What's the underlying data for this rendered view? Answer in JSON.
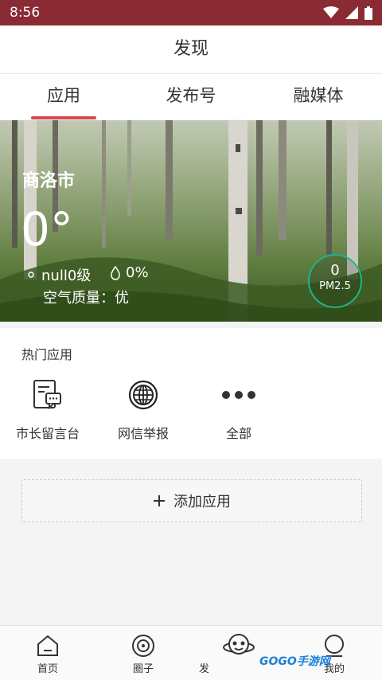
{
  "status": {
    "time": "8:56"
  },
  "page": {
    "title": "发现"
  },
  "tabs": [
    {
      "label": "应用"
    },
    {
      "label": "发布号"
    },
    {
      "label": "融媒体"
    }
  ],
  "weather": {
    "city": "商洛市",
    "temperature": "0°",
    "wind": "null0级",
    "humidity": "0%",
    "air_quality": "空气质量：优",
    "pm_value": "0",
    "pm_label": "PM2.5",
    "accent_color": "#1fb58d"
  },
  "hot_apps": {
    "heading": "热门应用",
    "items": [
      {
        "label": "市长留言台",
        "icon": "message-board-icon"
      },
      {
        "label": "网信举报",
        "icon": "globe-icon"
      },
      {
        "label": "全部",
        "icon": "more-dots-icon"
      }
    ]
  },
  "add_app": {
    "label": "添加应用"
  },
  "bottom_nav": [
    {
      "label": "首页",
      "icon": "home-icon"
    },
    {
      "label": "圈子",
      "icon": "circle-icon"
    },
    {
      "label": "发",
      "icon": "planet-mascot-icon"
    },
    {
      "label": "我的",
      "icon": "profile-icon"
    }
  ],
  "watermark": "GOGO手游网",
  "colors": {
    "status_bar": "#8a2a33",
    "tab_indicator": "#d64b4b"
  }
}
